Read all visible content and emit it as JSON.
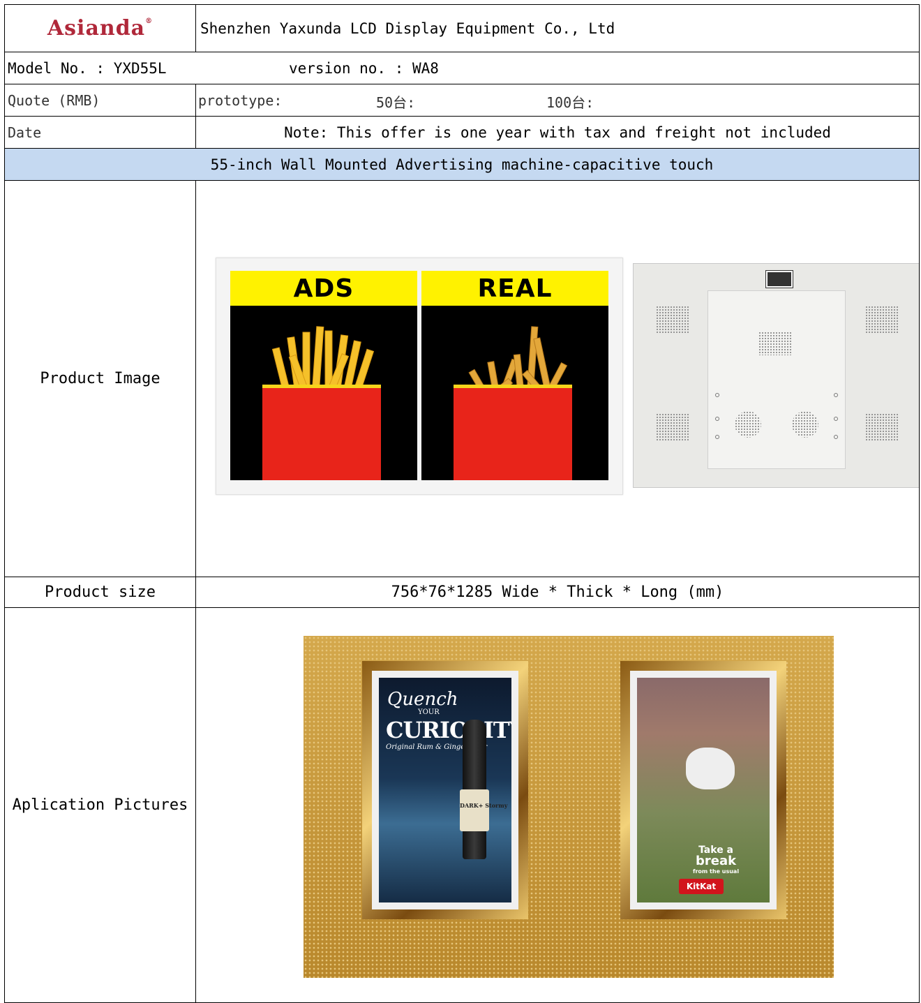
{
  "header": {
    "logo": "Asianda",
    "registered_mark": "®",
    "company": "Shenzhen Yaxunda LCD Display Equipment Co., Ltd"
  },
  "model_row": {
    "model": "Model No. : YXD55L",
    "version": "version no. : WA8"
  },
  "quote_row": {
    "label": "Quote (RMB)",
    "prototype": "prototype:",
    "qty50": "50台:",
    "qty100": "100台:"
  },
  "date_row": {
    "label": "Date",
    "note": "Note: This offer is one year with tax and freight not included"
  },
  "banner": "55-inch Wall Mounted Advertising machine-capacitive touch",
  "product_image": {
    "label": "Product Image",
    "ads_label": "ADS",
    "real_label": "REAL",
    "colors": {
      "yellow": "#fff200",
      "red_cup": "#e8241a",
      "panel": "#000000"
    }
  },
  "product_size": {
    "label": "Product size",
    "value": "756*76*1285   Wide * Thick * Long (mm)"
  },
  "application": {
    "label": "Aplication Pictures",
    "ad1_line1": "Quench",
    "ad1_line2": "YOUR",
    "ad1_line3": "CURIOSITY",
    "ad1_line4": "Original Rum & Ginger Beer",
    "ad1_bottle": "DARK+ Stormy",
    "ad2_line1": "Take a",
    "ad2_line2": "break",
    "ad2_line3": "from the usual",
    "ad2_brand": "KitKat"
  },
  "colors": {
    "banner_bg": "#c5d9f1",
    "logo": "#b0283a"
  }
}
